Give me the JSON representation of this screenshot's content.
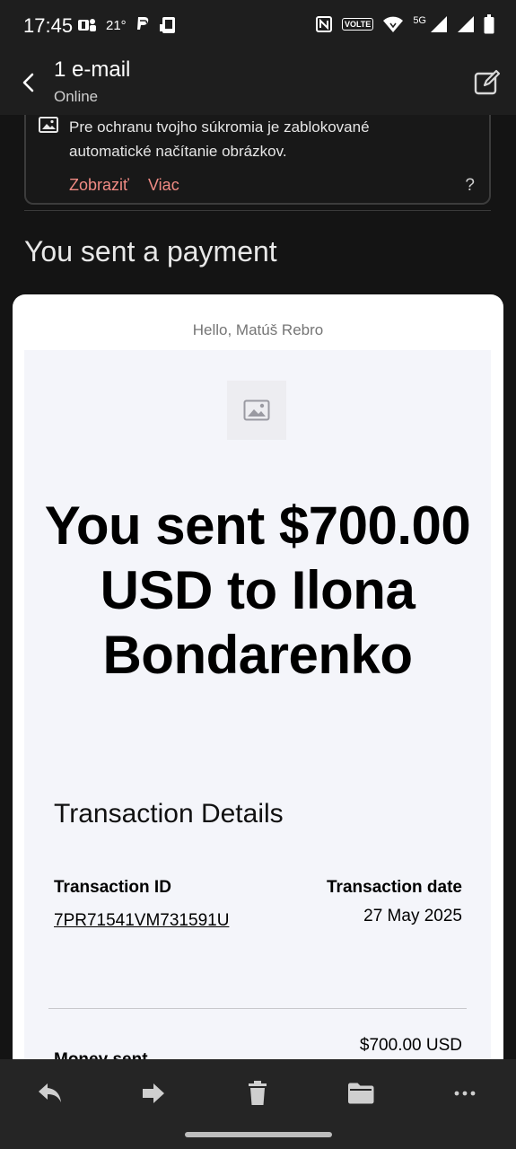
{
  "status_bar": {
    "time": "17:45",
    "temperature": "21°",
    "left_icons": [
      "teams-icon",
      "paypal-icon",
      "phone-pay-icon"
    ],
    "right_icons": [
      "nfc-icon",
      "volte-icon",
      "wifi-icon",
      "signal-icon",
      "signal-icon",
      "battery-icon"
    ],
    "volte_label": "VOLTE",
    "network_label": "5G"
  },
  "app_bar": {
    "title": "1 e-mail",
    "subtitle": "Online"
  },
  "privacy_banner": {
    "text": "Pre ochranu tvojho súkromia je zablokované automatické načítanie obrázkov.",
    "show_label": "Zobraziť",
    "more_label": "Viac",
    "help_label": "?"
  },
  "email": {
    "subject": "You sent a payment",
    "greeting": "Hello, Matúš Rebro",
    "headline": "You sent $700.00 USD to Ilona Bondarenko",
    "section_title": "Transaction Details",
    "transaction_id_label": "Transaction ID",
    "transaction_id": "7PR71541VM731591U",
    "transaction_date_label": "Transaction date",
    "transaction_date": "27 May 2025",
    "money_sent_label": "Money sent",
    "money_sent_value": "$700.00 USD"
  },
  "toolbar": {
    "items": [
      "reply-icon",
      "forward-icon",
      "delete-icon",
      "move-folder-icon",
      "more-icon"
    ]
  },
  "colors": {
    "accent_link": "#f08b84",
    "background": "#141414",
    "card": "#ffffff"
  }
}
